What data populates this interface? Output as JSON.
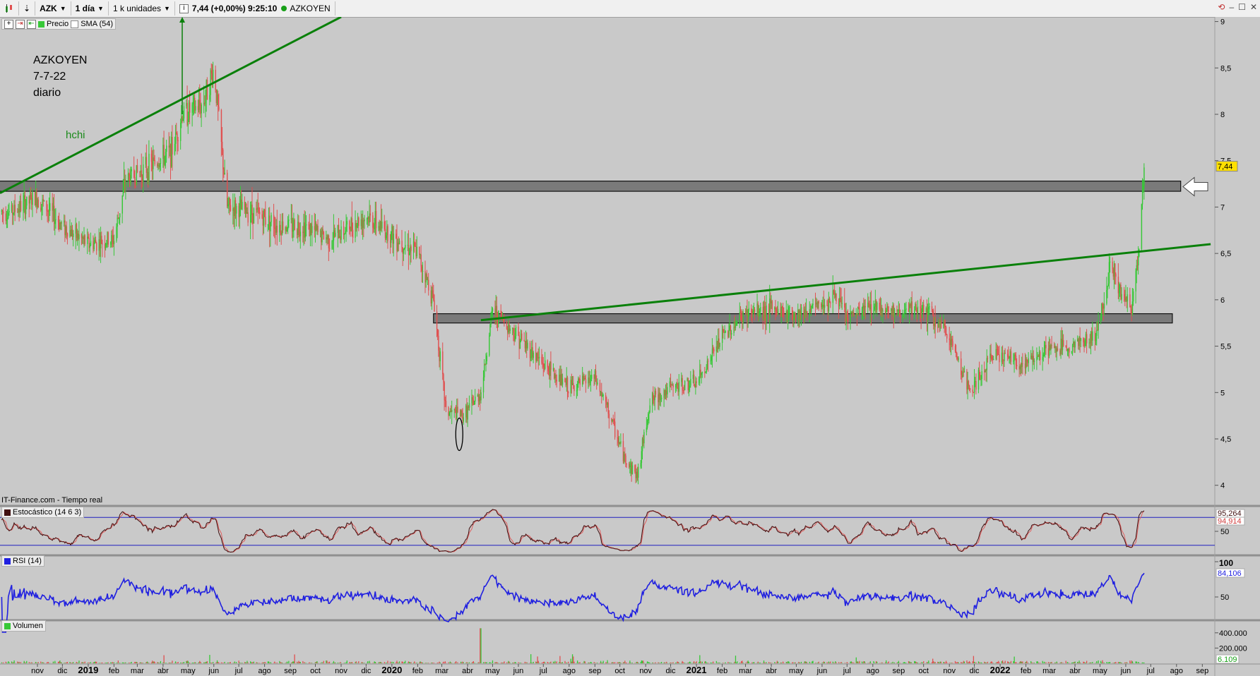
{
  "toolbar": {
    "symbol": "AZK",
    "period": "1 día",
    "units": "1 k unidades",
    "quote": "7,44 (+0,00%) 9:25:10",
    "instrument": "AZKOYEN"
  },
  "legend_main": {
    "price": "Precio",
    "sma": "SMA (54)"
  },
  "annotations": {
    "title": "AZKOYEN",
    "date": "7-7-22",
    "interval": "diario",
    "note": "hchi",
    "source": "IT-Finance.com - Tiempo real"
  },
  "panels": {
    "stoch": {
      "label": "Estocástico (14 6 3)",
      "value1": "95,264",
      "value2": "94,914",
      "tick50": "50"
    },
    "rsi": {
      "label": "RSI (14)",
      "value": "84,106",
      "tick100": "100",
      "tick50": "50"
    },
    "volume": {
      "label": "Volumen",
      "tick400": "400.000",
      "tick200": "200.000",
      "value": "6.109"
    }
  },
  "colors": {
    "up": "#37c837",
    "down": "#e05050",
    "trend": "#0a800a",
    "rsi": "#2020e0",
    "bg": "#c9c9c9",
    "price_tag": "#ffe000"
  },
  "chart_data": {
    "type": "candlestick",
    "title": "AZKOYEN",
    "ylim": [
      3.8,
      9.05
    ],
    "y_ticks": [
      "9",
      "8,5",
      "8",
      "7,5",
      "7",
      "6,5",
      "6",
      "5,5",
      "5",
      "4,5",
      "4"
    ],
    "x_ticks": [
      "nov",
      "dic",
      "2019",
      "feb",
      "mar",
      "abr",
      "may",
      "jun",
      "jul",
      "ago",
      "sep",
      "oct",
      "nov",
      "dic",
      "2020",
      "feb",
      "mar",
      "abr",
      "may",
      "jun",
      "jul",
      "ago",
      "sep",
      "oct",
      "nov",
      "dic",
      "2021",
      "feb",
      "mar",
      "abr",
      "may",
      "jun",
      "jul",
      "ago",
      "sep",
      "oct",
      "nov",
      "dic",
      "2022",
      "feb",
      "mar",
      "abr",
      "may",
      "jun",
      "jul",
      "ago",
      "sep"
    ],
    "last_price": "7,44",
    "price_path": [
      [
        "2018-10-15",
        6.95
      ],
      [
        "2018-11-15",
        7.1
      ],
      [
        "2018-12-15",
        6.8
      ],
      [
        "2019-01-15",
        6.6
      ],
      [
        "2019-02-15",
        6.65
      ],
      [
        "2019-03-01",
        7.3
      ],
      [
        "2019-04-01",
        7.45
      ],
      [
        "2019-04-25",
        7.6
      ],
      [
        "2019-05-08",
        8.0
      ],
      [
        "2019-06-01",
        8.1
      ],
      [
        "2019-06-15",
        8.5
      ],
      [
        "2019-07-01",
        7.0
      ],
      [
        "2019-08-01",
        6.95
      ],
      [
        "2019-09-01",
        6.8
      ],
      [
        "2019-10-01",
        6.8
      ],
      [
        "2019-11-01",
        6.65
      ],
      [
        "2019-12-15",
        6.9
      ],
      [
        "2020-01-15",
        6.7
      ],
      [
        "2020-02-15",
        6.5
      ],
      [
        "2020-03-05",
        6.0
      ],
      [
        "2020-03-20",
        4.8
      ],
      [
        "2020-04-10",
        4.75
      ],
      [
        "2020-05-01",
        5.0
      ],
      [
        "2020-05-15",
        5.9
      ],
      [
        "2020-06-15",
        5.6
      ],
      [
        "2020-07-15",
        5.3
      ],
      [
        "2020-08-15",
        5.05
      ],
      [
        "2020-09-15",
        5.15
      ],
      [
        "2020-10-01",
        4.8
      ],
      [
        "2020-10-20",
        4.3
      ],
      [
        "2020-11-05",
        4.1
      ],
      [
        "2020-11-20",
        4.9
      ],
      [
        "2020-12-15",
        5.05
      ],
      [
        "2021-01-15",
        5.1
      ],
      [
        "2021-02-15",
        5.6
      ],
      [
        "2021-03-15",
        5.85
      ],
      [
        "2021-04-15",
        5.9
      ],
      [
        "2021-05-15",
        5.85
      ],
      [
        "2021-06-15",
        5.95
      ],
      [
        "2021-07-01",
        6.05
      ],
      [
        "2021-07-15",
        5.8
      ],
      [
        "2021-08-15",
        5.95
      ],
      [
        "2021-09-15",
        5.85
      ],
      [
        "2021-10-15",
        5.9
      ],
      [
        "2021-11-15",
        5.6
      ],
      [
        "2021-12-10",
        5.0
      ],
      [
        "2022-01-10",
        5.45
      ],
      [
        "2022-02-10",
        5.3
      ],
      [
        "2022-03-10",
        5.45
      ],
      [
        "2022-04-10",
        5.5
      ],
      [
        "2022-05-10",
        5.6
      ],
      [
        "2022-05-28",
        6.4
      ],
      [
        "2022-06-10",
        6.05
      ],
      [
        "2022-06-22",
        5.9
      ],
      [
        "2022-07-01",
        6.6
      ],
      [
        "2022-07-07",
        7.44
      ]
    ],
    "zones": [
      {
        "from": "2018-09-25",
        "to": "2022-08-20",
        "low": 7.17,
        "high": 7.28
      },
      {
        "from": "2020-03-05",
        "to": "2022-08-10",
        "low": 5.75,
        "high": 5.85
      }
    ],
    "trendlines": [
      {
        "x1": "2018-10-01",
        "y1": 7.15,
        "x2": "2019-11-15",
        "y2": 9.05
      },
      {
        "x1": "2020-05-01",
        "y1": 5.78,
        "x2": "2022-09-25",
        "y2": 6.6
      }
    ],
    "volume_ylim": [
      0,
      500000
    ],
    "volume_ticks": [
      "400.000",
      "200.000"
    ],
    "stoch_ylim": [
      0,
      100
    ],
    "rsi_ylim": [
      20,
      100
    ]
  }
}
